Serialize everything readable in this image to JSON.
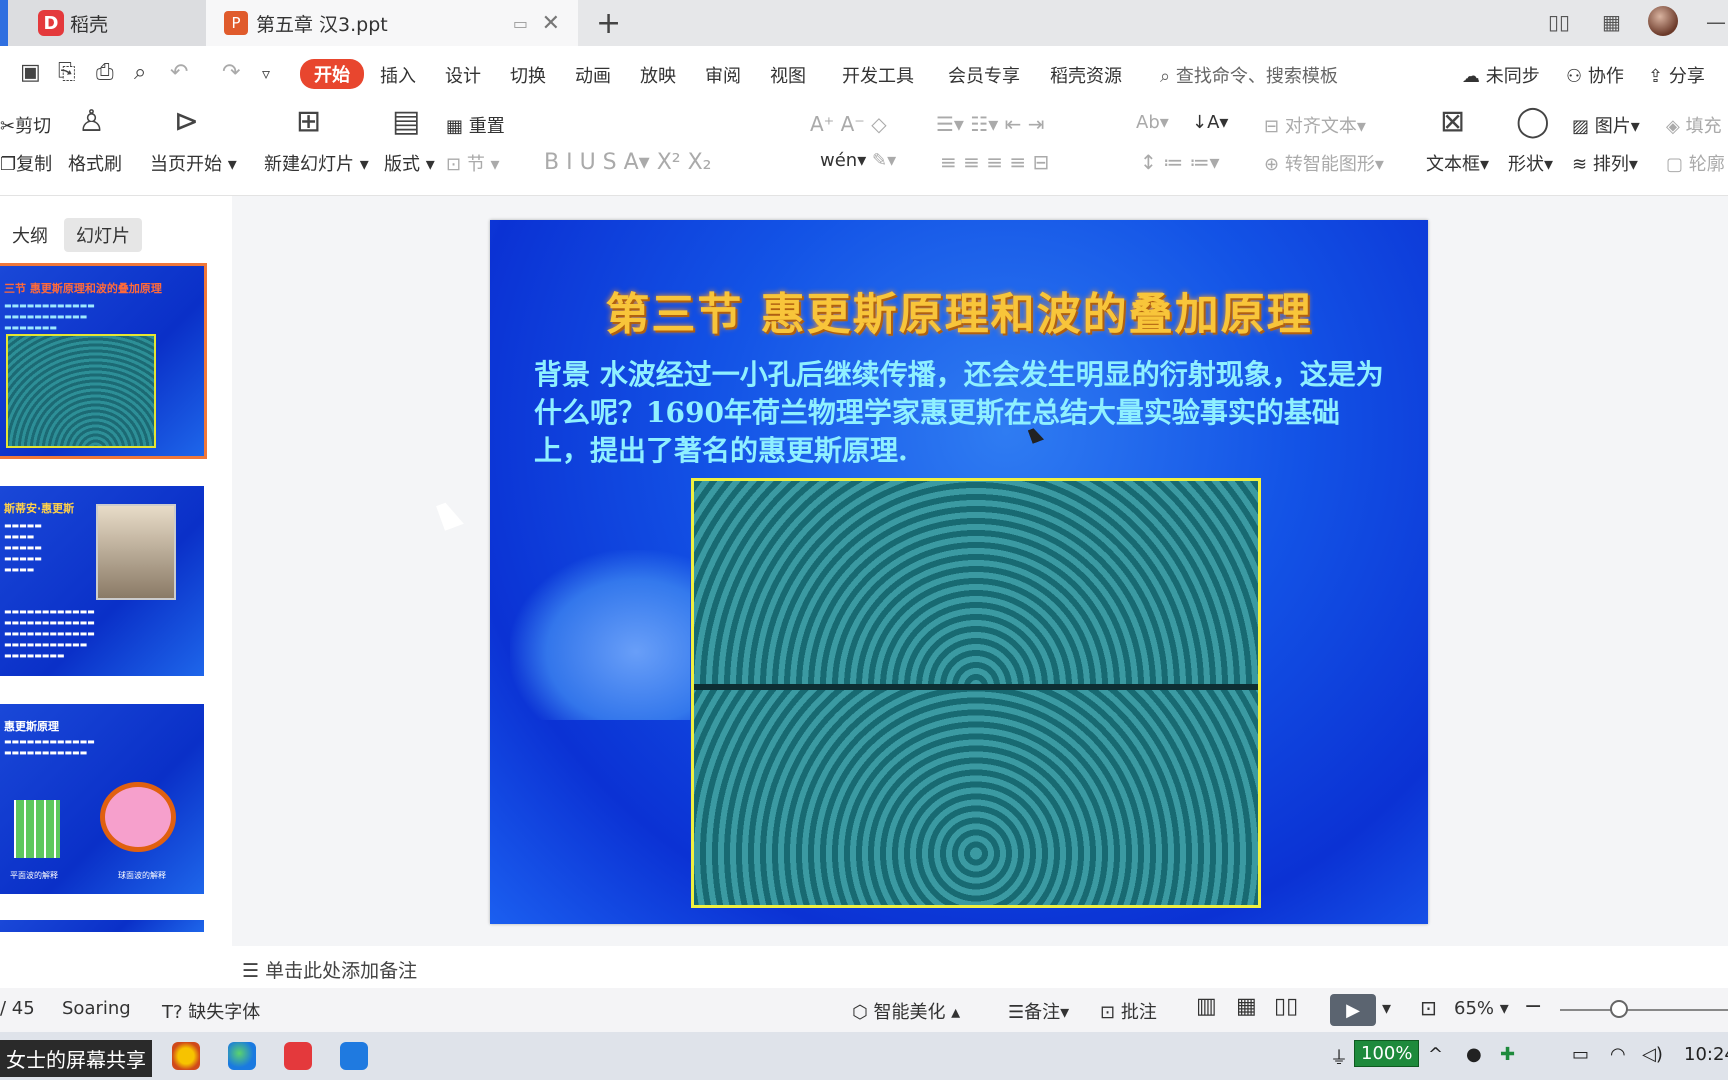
{
  "tabbar": {
    "home_tab": "稻壳",
    "doc_tab": "第五章 汉3.ppt",
    "add_icon": "plus-icon",
    "close_icon": "close-icon"
  },
  "menu": {
    "items": [
      "开始",
      "插入",
      "设计",
      "切换",
      "动画",
      "放映",
      "审阅",
      "视图",
      "开发工具",
      "会员专享",
      "稻壳资源"
    ],
    "active": "开始",
    "search_placeholder": "查找命令、搜索模板",
    "sync": "未同步",
    "collab": "协作",
    "share": "分享"
  },
  "ribbon": {
    "cut": "剪切",
    "copy": "复制",
    "format_painter": "格式刷",
    "from_current": "当页开始",
    "new_slide": "新建幻灯片",
    "layout": "版式",
    "reset": "重置",
    "section": "节",
    "align_text": "对齐文本",
    "smart_shape": "转智能图形",
    "textbox": "文本框",
    "shape": "形状",
    "picture": "图片",
    "arrange": "排列",
    "fill": "填充",
    "outline": "轮廓"
  },
  "panel": {
    "tab_outline": "大纲",
    "tab_slides": "幻灯片",
    "thumb1_title": "三节  惠更斯原理和波的叠加原理",
    "thumb2_title": "斯蒂安·惠更斯",
    "thumb3_title": "惠更斯原理",
    "thumb3_label_left": "平面波的解释",
    "thumb3_label_right": "球面波的解释"
  },
  "slide": {
    "title": "第三节  惠更斯原理和波的叠加原理",
    "body": "背景  水波经过一小孔后继续传播，还会发生明显的衍射现象，这是为什么呢？1690年荷兰物理学家惠更斯在总结大量实验事实的基础上，提出了著名的惠更斯原理."
  },
  "notes": {
    "placeholder": "单击此处添加备注"
  },
  "status": {
    "page": "/ 45",
    "theme": "Soaring",
    "missing_font": "缺失字体",
    "beautify": "智能美化",
    "notes_btn": "备注",
    "comment": "批注",
    "zoom": "65%"
  },
  "taskbar": {
    "share_label": "女士的屏幕共享",
    "battery": "100%",
    "time": "10:24"
  }
}
